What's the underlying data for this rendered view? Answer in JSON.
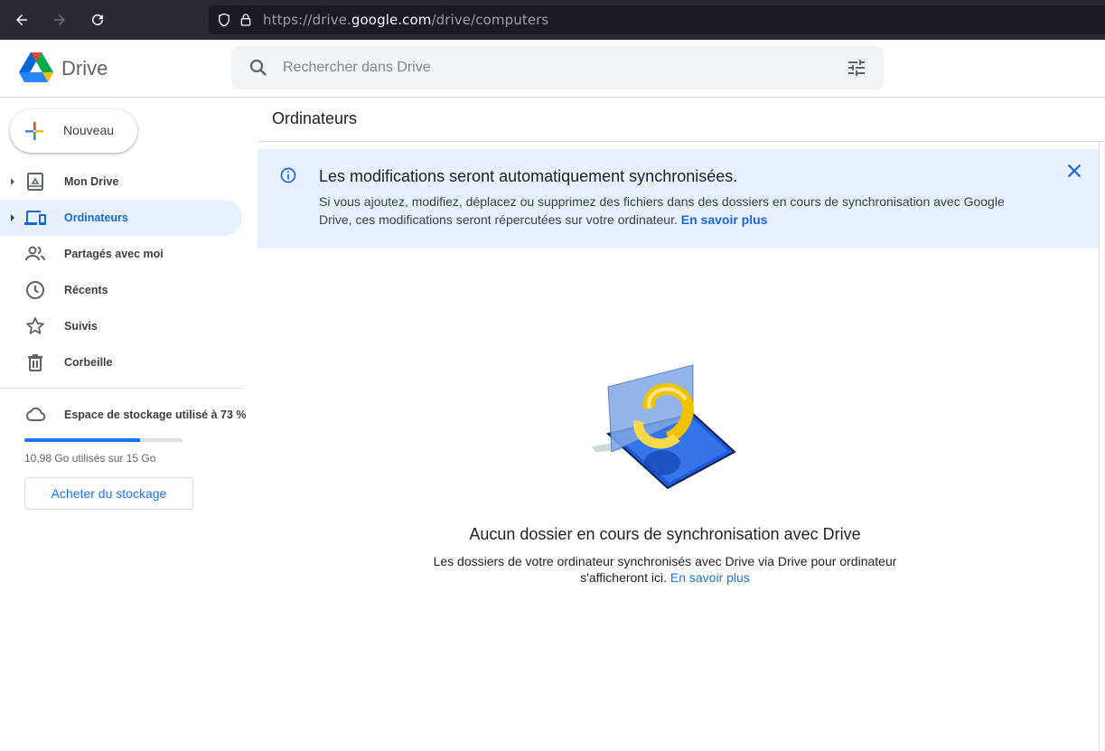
{
  "browser": {
    "url_prefix": "https://drive.",
    "url_domain": "google.com",
    "url_path": "/drive/computers"
  },
  "header": {
    "app_name": "Drive",
    "search_placeholder": "Rechercher dans Drive"
  },
  "sidebar": {
    "new_label": "Nouveau",
    "items": [
      {
        "label": "Mon Drive",
        "icon": "my-drive-icon",
        "expandable": true,
        "active": false
      },
      {
        "label": "Ordinateurs",
        "icon": "computers-icon",
        "expandable": true,
        "active": true
      },
      {
        "label": "Partagés avec moi",
        "icon": "shared-icon",
        "expandable": false,
        "active": false
      },
      {
        "label": "Récents",
        "icon": "clock-icon",
        "expandable": false,
        "active": false
      },
      {
        "label": "Suivis",
        "icon": "star-icon",
        "expandable": false,
        "active": false
      },
      {
        "label": "Corbeille",
        "icon": "trash-icon",
        "expandable": false,
        "active": false
      }
    ],
    "storage": {
      "label": "Espace de stockage utilisé à 73 %",
      "percent": 73,
      "detail": "10,98 Go utilisés sur 15 Go",
      "buy_label": "Acheter du stockage"
    }
  },
  "main": {
    "title": "Ordinateurs",
    "banner": {
      "title": "Les modifications seront automatiquement synchronisées.",
      "body": "Si vous ajoutez, modifiez, déplacez ou supprimez des fichiers dans des dossiers en cours de synchronisation avec Google Drive, ces modifications seront répercutées sur votre ordinateur.",
      "link": "En savoir plus"
    },
    "empty": {
      "title": "Aucun dossier en cours de synchronisation avec Drive",
      "body": "Les dossiers de votre ordinateur synchronisés avec Drive via Drive pour ordinateur s'afficheront ici.",
      "link": "En savoir plus"
    }
  },
  "colors": {
    "accent": "#1a73e8",
    "active_bg": "#e8f0fe",
    "banner_bg": "#e8f0fe"
  }
}
